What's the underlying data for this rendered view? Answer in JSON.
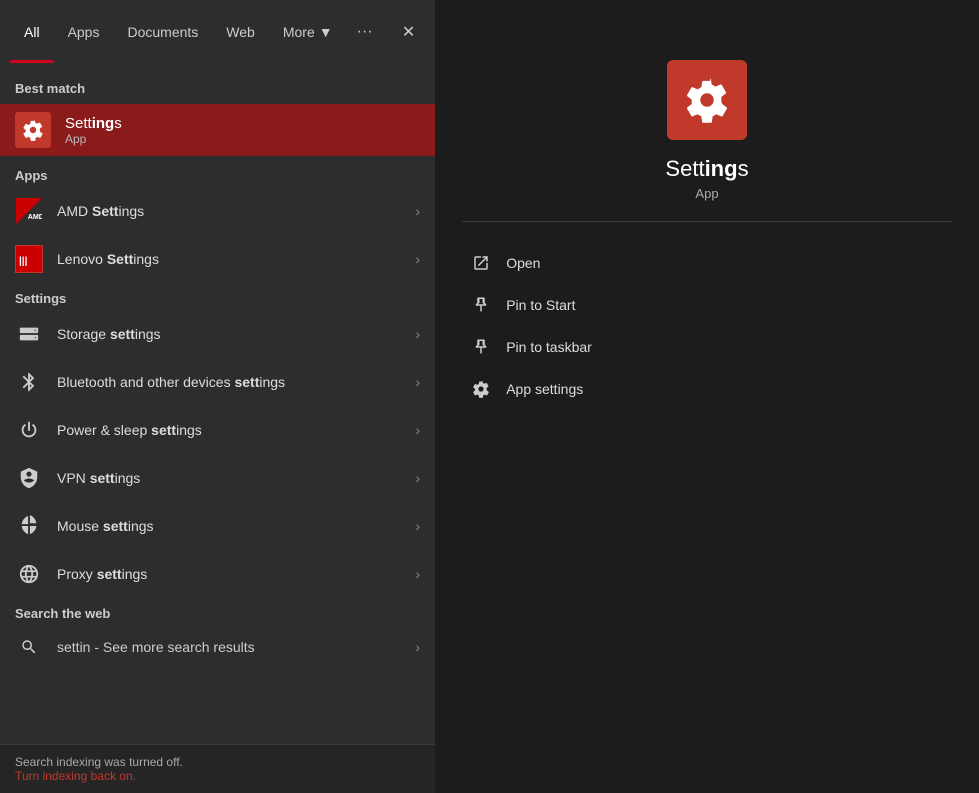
{
  "tabs": {
    "items": [
      {
        "label": "All",
        "active": true
      },
      {
        "label": "Apps",
        "active": false
      },
      {
        "label": "Documents",
        "active": false
      },
      {
        "label": "Web",
        "active": false
      },
      {
        "label": "More",
        "active": false,
        "hasChevron": true
      }
    ],
    "controls": {
      "ellipsis": "···",
      "close": "✕"
    }
  },
  "bestMatch": {
    "header": "Best match",
    "icon": "gear",
    "titleBefore": "Sett",
    "titleBold": "ing",
    "titleAfter": "s",
    "subtitle": "App"
  },
  "appsSection": {
    "header": "Apps",
    "items": [
      {
        "iconType": "amd",
        "labelBefore": "AMD ",
        "labelBold": "Sett",
        "labelAfter": "ings"
      },
      {
        "iconType": "lenovo",
        "labelBefore": "Lenovo ",
        "labelBold": "Sett",
        "labelAfter": "ings"
      }
    ]
  },
  "settingsSection": {
    "header": "Settings",
    "items": [
      {
        "iconType": "storage",
        "labelBefore": "Storage ",
        "labelBold": "sett",
        "labelAfter": "ings"
      },
      {
        "iconType": "bluetooth",
        "labelBefore": "Bluetooth and other devices ",
        "labelBold": "sett",
        "labelAfter": "ings"
      },
      {
        "iconType": "power",
        "labelBefore": "Power & sleep ",
        "labelBold": "sett",
        "labelAfter": "ings"
      },
      {
        "iconType": "vpn",
        "labelBefore": "VPN ",
        "labelBold": "sett",
        "labelAfter": "ings"
      },
      {
        "iconType": "mouse",
        "labelBefore": "Mouse ",
        "labelBold": "sett",
        "labelAfter": "ings"
      },
      {
        "iconType": "proxy",
        "labelBefore": "Proxy ",
        "labelBold": "sett",
        "labelAfter": "ings"
      }
    ]
  },
  "searchWeb": {
    "header": "Search the web",
    "query": "settin",
    "labelBefore": "settin",
    "labelAfter": " - See more search results"
  },
  "statusBar": {
    "message": "Search indexing was turned off.",
    "linkText": "Turn indexing back on."
  },
  "rightPanel": {
    "appName_before": "Sett",
    "appName_bold": "ing",
    "appName_after": "s",
    "appType": "App",
    "actions": [
      {
        "label": "Open",
        "iconType": "open"
      },
      {
        "label": "Pin to Start",
        "iconType": "pin-start"
      },
      {
        "label": "Pin to taskbar",
        "iconType": "pin-taskbar"
      },
      {
        "label": "App settings",
        "iconType": "gear"
      }
    ]
  }
}
